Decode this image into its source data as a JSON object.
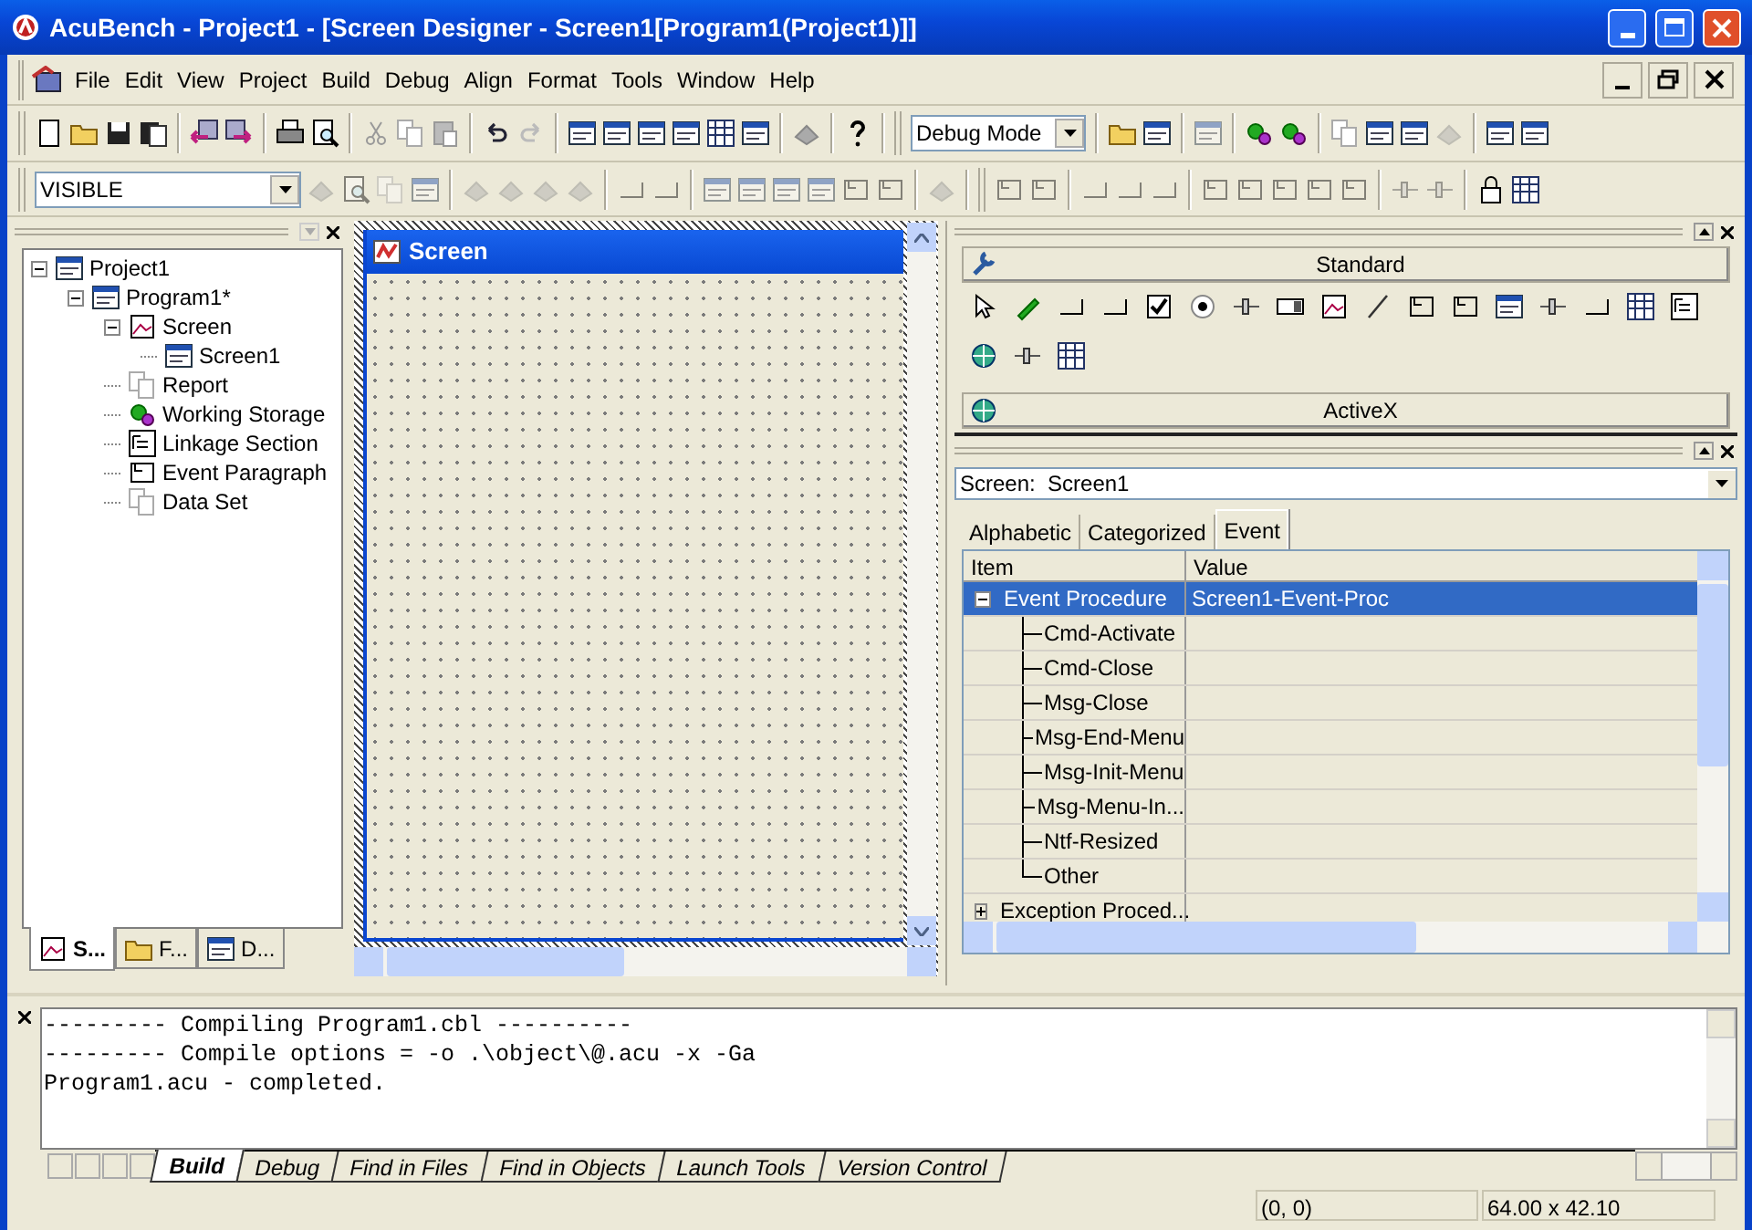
{
  "window": {
    "title": "AcuBench - Project1 - [Screen Designer - Screen1[Program1(Project1)]]"
  },
  "menu": [
    {
      "label": "File"
    },
    {
      "label": "Edit"
    },
    {
      "label": "View"
    },
    {
      "label": "Project"
    },
    {
      "label": "Build"
    },
    {
      "label": "Debug"
    },
    {
      "label": "Align"
    },
    {
      "label": "Format"
    },
    {
      "label": "Tools"
    },
    {
      "label": "Window"
    },
    {
      "label": "Help"
    }
  ],
  "toolbar": {
    "mode_combo": "Debug Mode"
  },
  "format_toolbar": {
    "style_combo": "VISIBLE"
  },
  "project_tree": [
    {
      "label": "Project1",
      "expanded": true,
      "children": [
        {
          "label": "Program1*",
          "expanded": true,
          "children": [
            {
              "label": "Screen",
              "expanded": true,
              "children": [
                {
                  "label": "Screen1"
                }
              ]
            },
            {
              "label": "Report"
            },
            {
              "label": "Working Storage"
            },
            {
              "label": "Linkage Section"
            },
            {
              "label": "Event Paragraph"
            },
            {
              "label": "Data Set"
            }
          ]
        }
      ]
    }
  ],
  "workspace_tabs": [
    {
      "label": "S...",
      "selected": true
    },
    {
      "label": "F...",
      "selected": false
    },
    {
      "label": "D...",
      "selected": false
    }
  ],
  "designer": {
    "title": "Screen"
  },
  "toolbox": {
    "groups": [
      {
        "label": "Standard"
      },
      {
        "label": "ActiveX"
      }
    ]
  },
  "properties": {
    "object": "Screen:  Screen1",
    "tabs": [
      {
        "label": "Alphabetic",
        "selected": false
      },
      {
        "label": "Categorized",
        "selected": false
      },
      {
        "label": "Event",
        "selected": true
      }
    ],
    "columns": [
      "Item",
      "Value"
    ],
    "rows": [
      {
        "item": "Event Procedure",
        "value": "Screen1-Event-Proc",
        "selected": true,
        "expanded": true,
        "children": [
          {
            "item": "Cmd-Activate",
            "selected": false
          },
          {
            "item": "Cmd-Close",
            "selected": false
          },
          {
            "item": "Msg-Close",
            "selected": false
          },
          {
            "item": "Msg-End-Menu",
            "selected": false
          },
          {
            "item": "Msg-Init-Menu",
            "selected": false
          },
          {
            "item": "Msg-Menu-In...",
            "selected": false
          },
          {
            "item": "Ntf-Resized",
            "selected": false
          },
          {
            "item": "Other",
            "selected": false
          }
        ]
      },
      {
        "item": "Exception Proced...",
        "selected": false,
        "expanded": false
      }
    ]
  },
  "output": {
    "lines": [
      "--------- Compiling Program1.cbl ----------",
      "--------- Compile options = -o .\\object\\@.acu -x -Ga",
      "Program1.acu - completed."
    ],
    "tabs": [
      {
        "label": "Build",
        "selected": true
      },
      {
        "label": "Debug",
        "selected": false
      },
      {
        "label": "Find in Files",
        "selected": false
      },
      {
        "label": "Find in Objects",
        "selected": false
      },
      {
        "label": "Launch Tools",
        "selected": false
      },
      {
        "label": "Version Control",
        "selected": false
      }
    ]
  },
  "status_bar": {
    "position": "(0, 0)",
    "size": "64.00 x 42.10"
  }
}
